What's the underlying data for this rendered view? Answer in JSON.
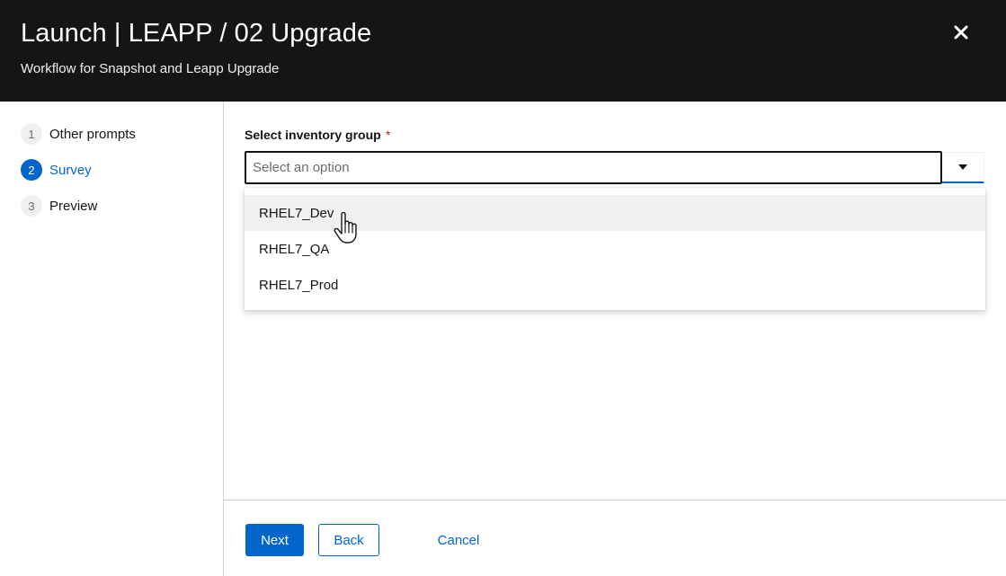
{
  "header": {
    "title": "Launch | LEAPP / 02 Upgrade",
    "subtitle": "Workflow for Snapshot and Leapp Upgrade",
    "close_icon": "close-icon"
  },
  "nav": {
    "steps": [
      {
        "number": "1",
        "label": "Other prompts",
        "current": false
      },
      {
        "number": "2",
        "label": "Survey",
        "current": true
      },
      {
        "number": "3",
        "label": "Preview",
        "current": false
      }
    ]
  },
  "form": {
    "label": "Select inventory group",
    "required_mark": "*",
    "placeholder": "Select an option",
    "options": [
      "RHEL7_Dev",
      "RHEL7_QA",
      "RHEL7_Prod"
    ],
    "hovered_option": "RHEL7_Dev"
  },
  "footer": {
    "next_label": "Next",
    "back_label": "Back",
    "cancel_label": "Cancel"
  },
  "colors": {
    "header_bg": "#151515",
    "accent": "#0066cc",
    "required": "#c9190b",
    "hover_bg": "#f0f0f0"
  }
}
